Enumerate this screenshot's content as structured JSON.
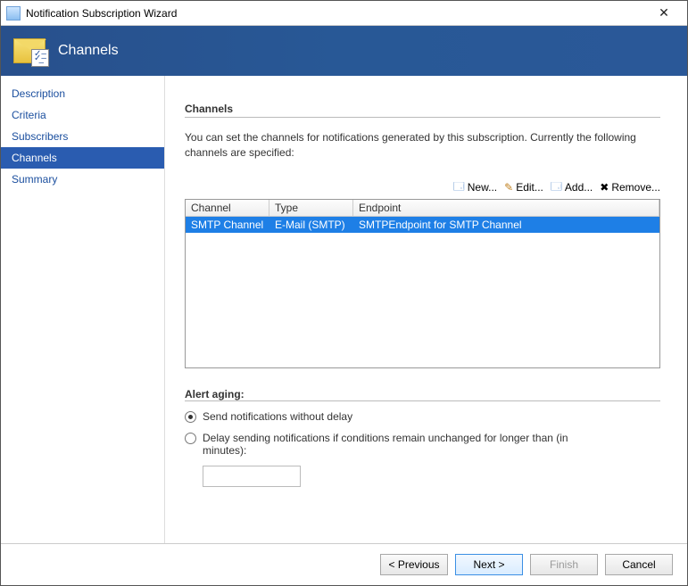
{
  "window": {
    "title": "Notification Subscription Wizard",
    "close": "✕"
  },
  "banner": {
    "title": "Channels",
    "checklist": "✓–\n✓–\n  –"
  },
  "sidebar": {
    "items": [
      {
        "label": "Description"
      },
      {
        "label": "Criteria"
      },
      {
        "label": "Subscribers"
      },
      {
        "label": "Channels"
      },
      {
        "label": "Summary"
      }
    ],
    "selected": 3
  },
  "main": {
    "heading": "Channels",
    "description": "You can set the channels for notifications generated by this subscription.  Currently the following channels are specified:",
    "toolbar": {
      "new": {
        "label": "New...",
        "glyph": "🗔"
      },
      "edit": {
        "label": "Edit...",
        "glyph": "✎"
      },
      "add": {
        "label": "Add...",
        "glyph": "🗔"
      },
      "remove": {
        "label": "Remove...",
        "glyph": "✖"
      }
    },
    "table": {
      "columns": [
        "Channel",
        "Type",
        "Endpoint"
      ],
      "rows": [
        {
          "channel": "SMTP Channel",
          "type": "E-Mail (SMTP)",
          "endpoint": "SMTPEndpoint for SMTP Channel"
        }
      ]
    },
    "aging": {
      "title": "Alert aging:",
      "opt_now": "Send notifications without delay",
      "opt_delay": "Delay sending notifications if conditions remain unchanged for longer than (in minutes):",
      "selected": "now",
      "delay_value": ""
    }
  },
  "footer": {
    "previous": "< Previous",
    "next": "Next >",
    "finish": "Finish",
    "cancel": "Cancel"
  }
}
